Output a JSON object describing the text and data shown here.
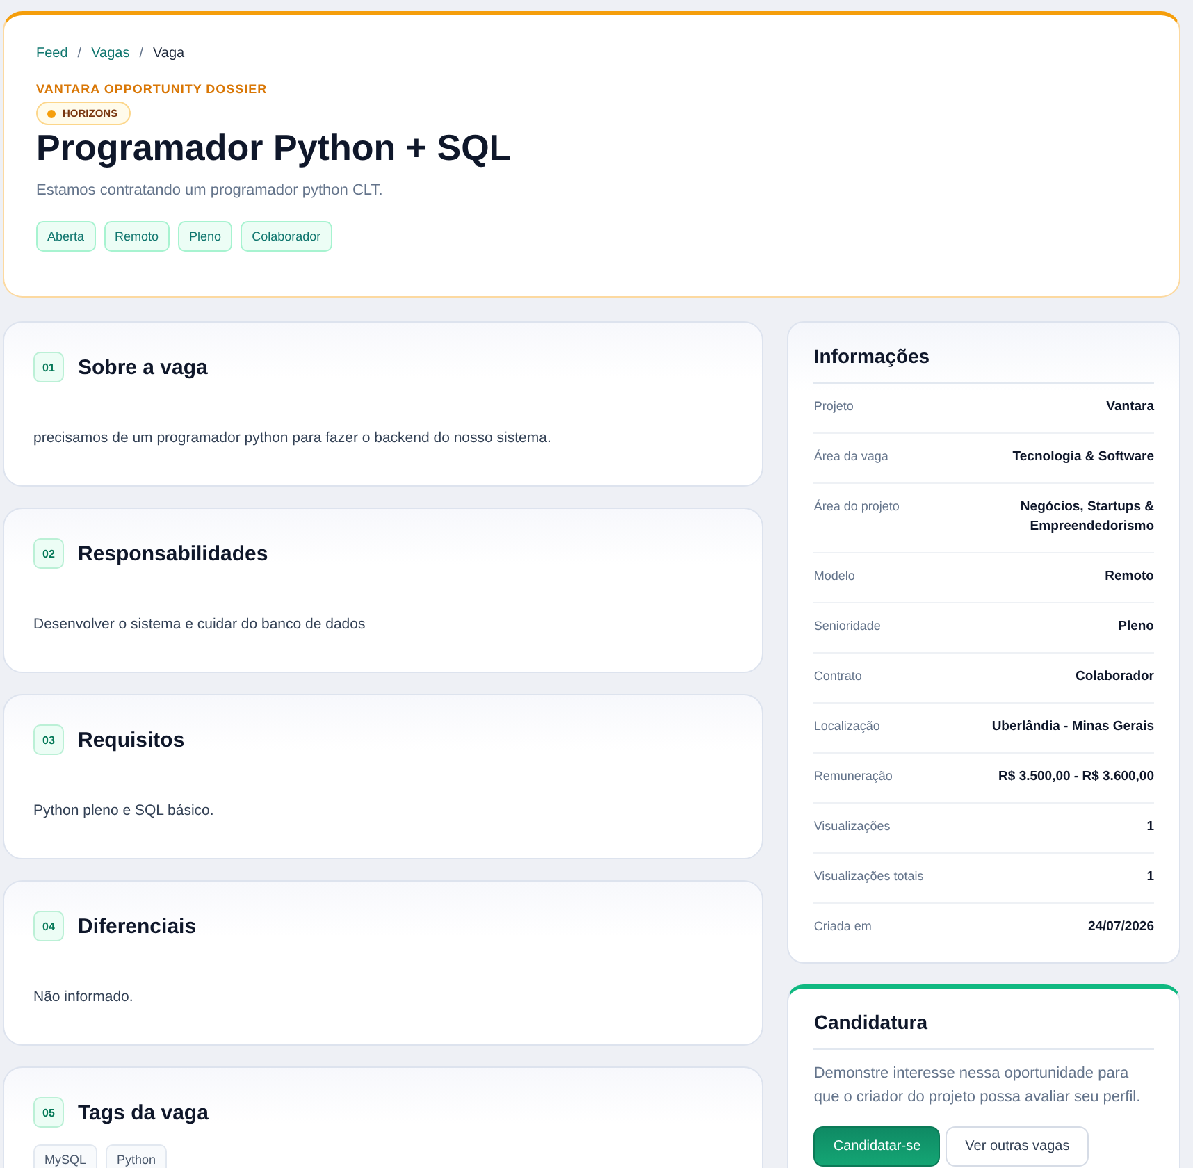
{
  "header": {
    "breadcrumb": [
      {
        "label": "Feed",
        "kind": "link"
      },
      {
        "label": "Vagas",
        "kind": "link"
      },
      {
        "label": "Vaga",
        "kind": "current"
      }
    ],
    "breadcrumb_separator": "/",
    "eyebrow": "VANTARA OPPORTUNITY DOSSIER",
    "badge": {
      "label": "HORIZONS",
      "color": "#f59e0b"
    },
    "title": "Programador Python + SQL",
    "subtitle": "Estamos contratando um programador python CLT.",
    "tags": [
      "Aberta",
      "Remoto",
      "Pleno",
      "Colaborador"
    ]
  },
  "sections": [
    {
      "number": "01",
      "title": "Sobre a vaga",
      "kind": "text",
      "body": "precisamos de um programador python para fazer o backend do nosso sistema."
    },
    {
      "number": "02",
      "title": "Responsabilidades",
      "kind": "text",
      "body": "Desenvolver o sistema e cuidar do banco de dados"
    },
    {
      "number": "03",
      "title": "Requisitos",
      "kind": "text",
      "body": "Python pleno e SQL básico."
    },
    {
      "number": "04",
      "title": "Diferenciais",
      "kind": "text",
      "body": "Não informado."
    },
    {
      "number": "05",
      "title": "Tags da vaga",
      "kind": "tags",
      "tags": [
        "MySQL",
        "Python"
      ]
    }
  ],
  "info": {
    "title": "Informações",
    "rows": [
      {
        "label": "Projeto",
        "value": "Vantara"
      },
      {
        "label": "Área da vaga",
        "value": "Tecnologia & Software"
      },
      {
        "label": "Área do projeto",
        "value": "Negócios, Startups & Empreendedorismo"
      },
      {
        "label": "Modelo",
        "value": "Remoto"
      },
      {
        "label": "Senioridade",
        "value": "Pleno"
      },
      {
        "label": "Contrato",
        "value": "Colaborador"
      },
      {
        "label": "Localização",
        "value": "Uberlândia - Minas Gerais"
      },
      {
        "label": "Remuneração",
        "value": "R$ 3.500,00 - R$ 3.600,00"
      },
      {
        "label": "Visualizações",
        "value": "1"
      },
      {
        "label": "Visualizações totais",
        "value": "1"
      },
      {
        "label": "Criada em",
        "value": "24/07/2026"
      }
    ]
  },
  "application": {
    "title": "Candidatura",
    "text": "Demonstre interesse nessa oportunidade para que o criador do projeto possa avaliar seu perfil.",
    "buttons": [
      {
        "label": "Candidatar-se",
        "kind": "primary"
      },
      {
        "label": "Ver outras vagas",
        "kind": "secondary"
      }
    ]
  }
}
